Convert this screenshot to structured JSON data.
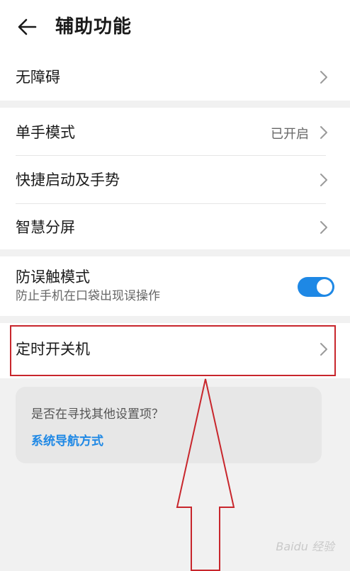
{
  "header": {
    "title": "辅助功能",
    "back_icon": "arrow-left-icon"
  },
  "groups": [
    {
      "items": [
        {
          "label": "无障碍"
        }
      ]
    },
    {
      "items": [
        {
          "label": "单手模式",
          "status": "已开启"
        },
        {
          "label": "快捷启动及手势"
        },
        {
          "label": "智慧分屏"
        }
      ]
    },
    {
      "items": [
        {
          "label": "防误触模式",
          "sublabel": "防止手机在口袋出现误操作",
          "toggle": true
        }
      ]
    },
    {
      "items": [
        {
          "label": "定时开关机"
        }
      ]
    }
  ],
  "suggestion": {
    "question": "是否在寻找其他设置项？",
    "link": "系统导航方式"
  },
  "colors": {
    "accent": "#1e88e5",
    "annotation_red": "#c8262c"
  },
  "watermark": "Baidu 经验"
}
